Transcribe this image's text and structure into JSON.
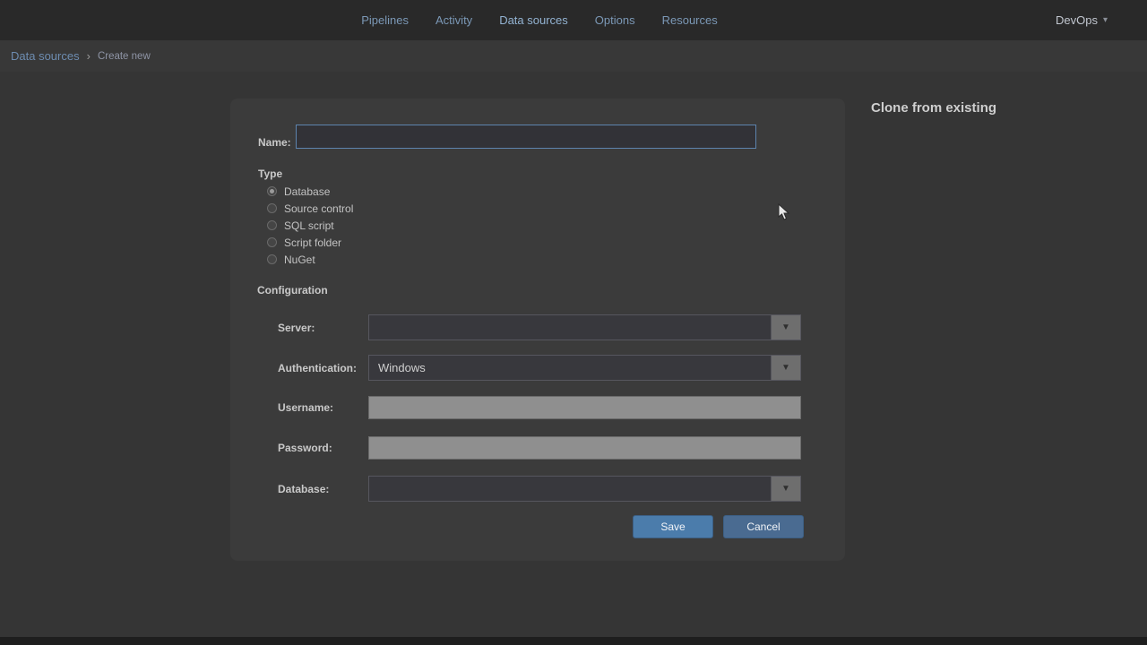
{
  "nav": {
    "items": [
      {
        "label": "Pipelines"
      },
      {
        "label": "Activity"
      },
      {
        "label": "Data sources"
      },
      {
        "label": "Options"
      },
      {
        "label": "Resources"
      }
    ],
    "active_item": "Data sources",
    "account": {
      "label": "DevOps"
    }
  },
  "breadcrumb": {
    "root": "Data sources",
    "current": "Create new"
  },
  "form": {
    "name_label": "Name:",
    "name_value": "",
    "type_heading": "Type",
    "type_options": [
      "Database",
      "Source control",
      "SQL script",
      "Script folder",
      "NuGet"
    ],
    "type_selected": "Database",
    "config_heading": "Configuration",
    "fields": [
      {
        "label": "Server:",
        "type": "dropdown",
        "value": ""
      },
      {
        "label": "Authentication:",
        "type": "dropdown",
        "value": "Windows"
      },
      {
        "label": "Username:",
        "type": "text",
        "value": ""
      },
      {
        "label": "Password:",
        "type": "password",
        "value": ""
      },
      {
        "label": "Database:",
        "type": "dropdown",
        "value": ""
      }
    ],
    "save_label": "Save",
    "cancel_label": "Cancel"
  },
  "side": {
    "clone_heading": "Clone from existing"
  },
  "colors": {
    "topbar": "#292929",
    "page_bg": "#353535",
    "card_bg": "#3b3b3b",
    "accent_link": "#6d8cb0",
    "save_button": "#4b7cab",
    "cancel_button": "#4a6b91",
    "focus_border": "#5d83ad"
  }
}
